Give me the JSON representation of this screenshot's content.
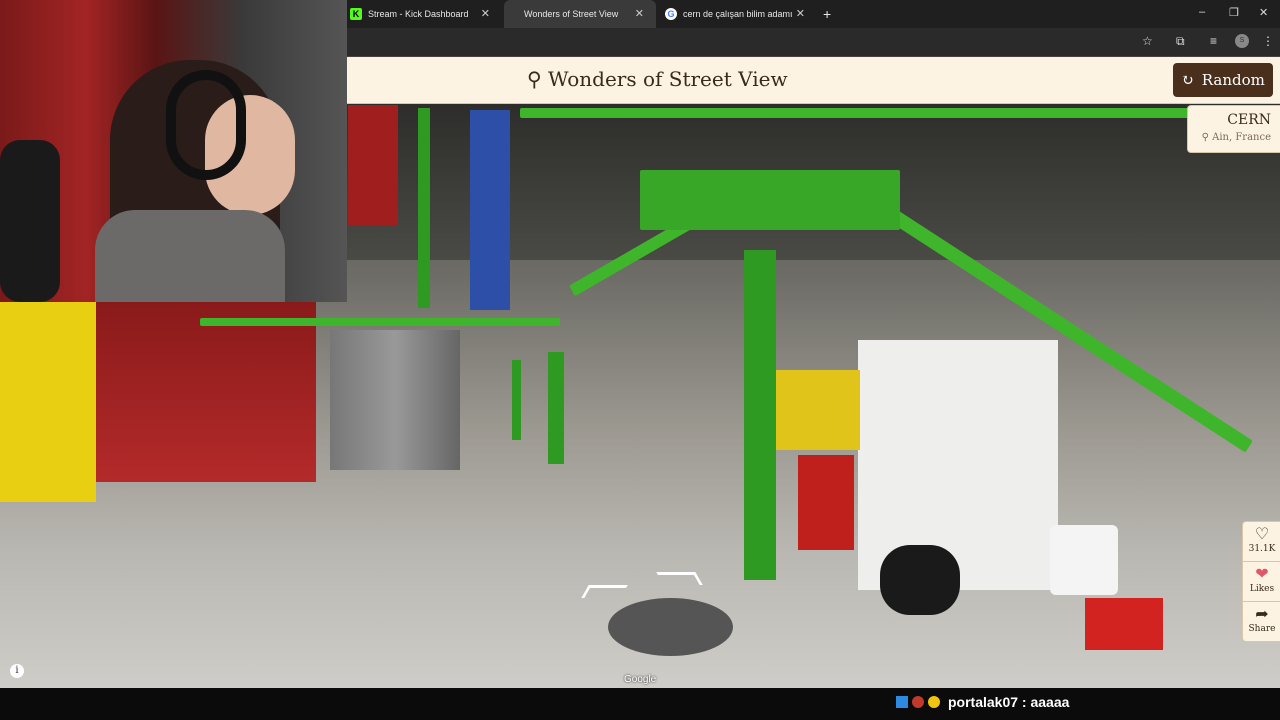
{
  "browser": {
    "tabs": [
      {
        "label": "Stream - Kick Dashboard",
        "icon": "kick-icon",
        "active": false
      },
      {
        "label": "Wonders of Street View",
        "icon": "page-icon",
        "active": true
      },
      {
        "label": "cern de çalışan bilim adamı - G",
        "icon": "google-icon",
        "active": false
      }
    ],
    "new_tab": "+",
    "minimize": "–",
    "restore": "❐",
    "close": "✕",
    "profile_initial": "S"
  },
  "page": {
    "title": "Wonders of Street View",
    "random_label": "Random",
    "location": {
      "name": "CERN",
      "region": "Ain, France"
    },
    "side": {
      "likes_count": "31.1K",
      "likes_label": "Likes",
      "share_label": "Share"
    },
    "google_label": "Google",
    "info_label": "i"
  },
  "overlay": {
    "chat_message": "portalak07 : aaaaa"
  },
  "colors": {
    "header_bg": "#fdf3e3",
    "button_bg": "#4a2f1c",
    "steel_green": "#3fb52b"
  }
}
